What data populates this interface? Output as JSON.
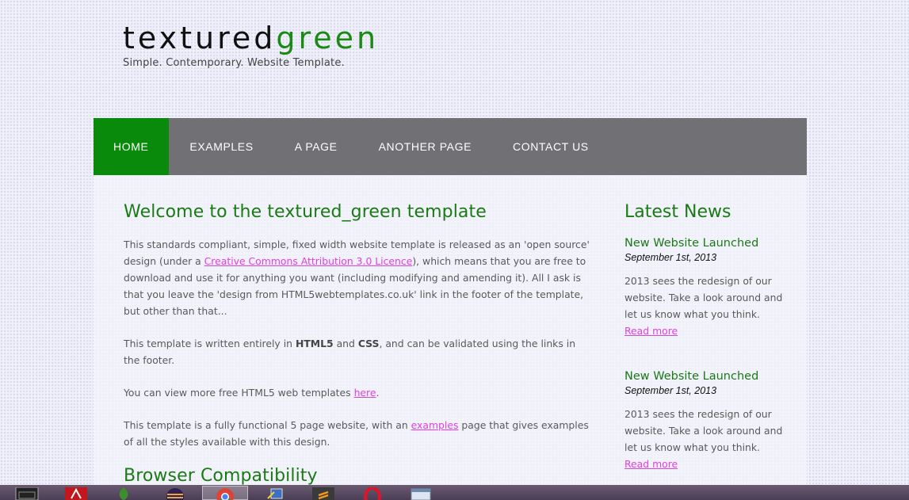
{
  "logo": {
    "title_part1": "textured",
    "title_part2": "green",
    "slogan": "Simple. Contemporary. Website Template."
  },
  "menu": [
    {
      "label": "HOME",
      "selected": true
    },
    {
      "label": "EXAMPLES"
    },
    {
      "label": "A PAGE"
    },
    {
      "label": "ANOTHER PAGE"
    },
    {
      "label": "CONTACT US"
    }
  ],
  "main": {
    "heading": "Welcome to the textured_green template",
    "p1_a": "This standards compliant, simple, fixed width website template is released as an 'open source' design (under a ",
    "p1_link": "Creative Commons Attribution 3.0 Licence",
    "p1_b": "), which means that you are free to download and use it for anything you want (including modifying and amending it). All I ask is that you leave the 'design from HTML5webtemplates.co.uk' link in the footer of the template, but other than that...",
    "p2_a": "This template is written entirely in ",
    "p2_b1": "HTML5",
    "p2_and": " and ",
    "p2_b2": "CSS",
    "p2_c": ", and can be validated using the links in the footer.",
    "p3_a": "You can view more free HTML5 web templates ",
    "p3_link": "here",
    "p3_b": ".",
    "p4_a": "This template is a fully functional 5 page website, with an ",
    "p4_link": "examples",
    "p4_b": " page that gives examples of all the styles available with this design.",
    "heading2": "Browser Compatibility"
  },
  "sidebar": {
    "title": "Latest News",
    "news": [
      {
        "title": "New Website Launched",
        "date": "September 1st, 2013",
        "body": "2013 sees the redesign of our website. Take a look around and let us know what you think.",
        "more": "Read more"
      },
      {
        "title": "New Website Launched",
        "date": "September 1st, 2013",
        "body": "2013 sees the redesign of our website. Take a look around and let us know what you think.",
        "more": "Read more"
      }
    ]
  },
  "colors": {
    "accent_green": "#1a7a14",
    "menu_bg": "#707075",
    "menu_selected": "#0a8a0a",
    "link": "#e040e0"
  },
  "taskbar": {
    "icons": [
      "djrazor-icon",
      "pdf-reader-icon",
      "leaf-app-icon",
      "eclipse-icon",
      "chrome-icon",
      "network-tool-icon",
      "sublime-text-icon",
      "opera-icon",
      "window-app-icon"
    ]
  }
}
